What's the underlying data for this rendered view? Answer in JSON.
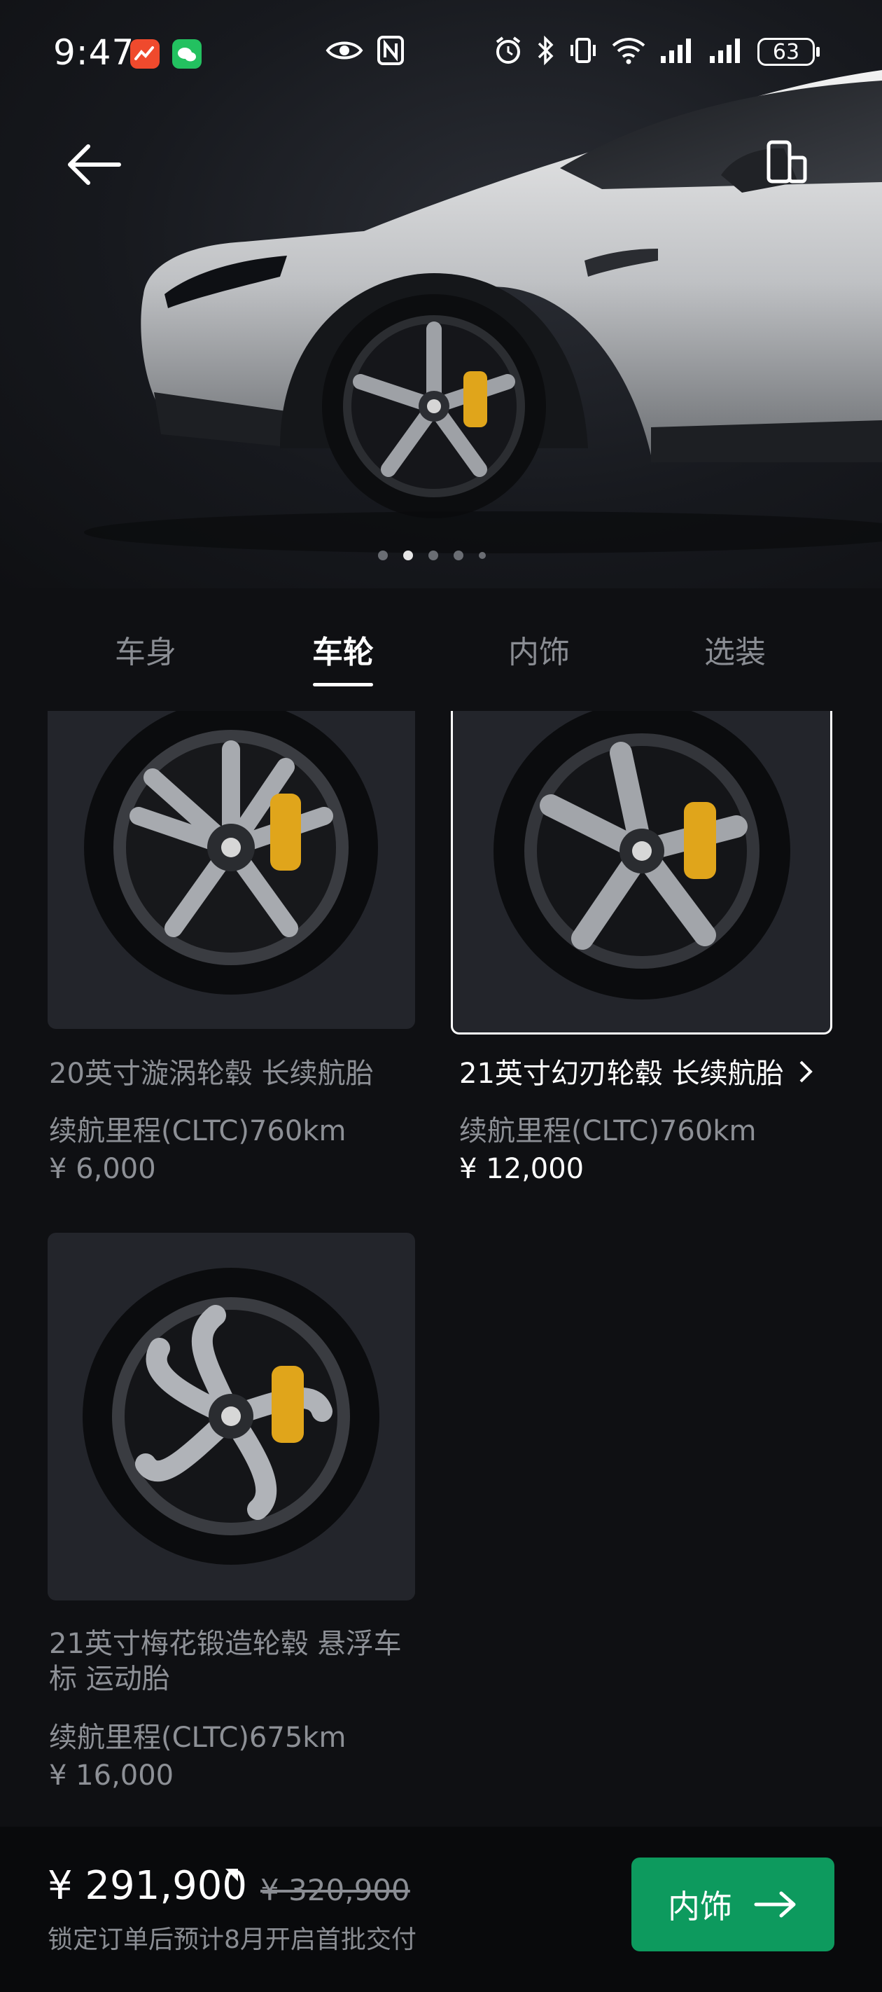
{
  "status_bar": {
    "time": "9:47",
    "battery": "63"
  },
  "tabs": [
    {
      "label": "车身"
    },
    {
      "label": "车轮"
    },
    {
      "label": "内饰"
    },
    {
      "label": "选装"
    }
  ],
  "wheels": [
    {
      "name": "20英寸漩涡轮毂 长续航胎",
      "range": "续航里程(CLTC)760km",
      "price": "¥ 6,000",
      "selected": false
    },
    {
      "name": "21英寸幻刃轮毂 长续航胎",
      "range": "续航里程(CLTC)760km",
      "price": "¥ 12,000",
      "selected": true
    },
    {
      "name": "21英寸梅花锻造轮毂 悬浮车标 运动胎",
      "range": "续航里程(CLTC)675km",
      "price": "¥ 16,000",
      "selected": false
    }
  ],
  "footer": {
    "total_price": "¥ 291,900",
    "original_price": "¥ 320,900",
    "delivery_note": "锁定订单后预计8月开启首批交付",
    "next_button": "内饰"
  },
  "colors": {
    "accent_green": "#0d9a5e",
    "caliper_yellow": "#e0a51b"
  }
}
